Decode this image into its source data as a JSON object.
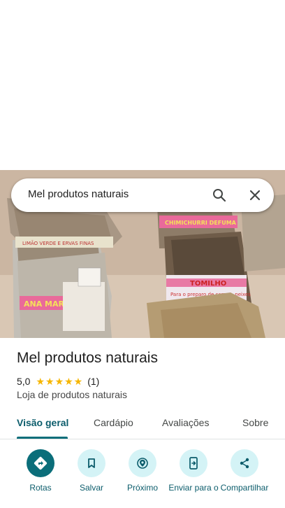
{
  "search": {
    "query": "Mel produtos naturais"
  },
  "photo": {
    "bag_labels": [
      "LIMÃO VERDE E ERVAS FINAS",
      "ANA MARIA",
      "CHIMICHURRI DEFUMA",
      "TOMILHO",
      "Para o preparo de carnes, peixes"
    ]
  },
  "place": {
    "name": "Mel produtos naturais",
    "rating": "5,0",
    "stars": "★★★★★",
    "review_count": "(1)",
    "category": "Loja de produtos naturais"
  },
  "tabs": [
    {
      "label": "Visão geral",
      "active": true
    },
    {
      "label": "Cardápio"
    },
    {
      "label": "Avaliações"
    },
    {
      "label": "Sobre"
    }
  ],
  "actions": [
    {
      "label": "Rotas",
      "icon": "directions-icon"
    },
    {
      "label": "Salvar",
      "icon": "bookmark-icon"
    },
    {
      "label": "Próximo",
      "icon": "nearby-icon"
    },
    {
      "label": "Enviar para o",
      "icon": "send-to-phone-icon"
    },
    {
      "label": "Compartilhar",
      "icon": "share-icon"
    }
  ],
  "colors": {
    "accent": "#0b6e7a",
    "accent_text": "#0b5c6b",
    "chip_bg": "#d4f3f6",
    "star": "#f6b600"
  }
}
